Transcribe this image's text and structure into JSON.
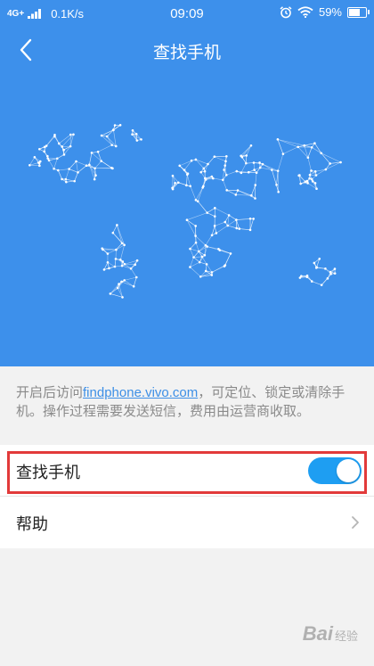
{
  "status_bar": {
    "network": "4G+",
    "speed": "0.1K/s",
    "time": "09:09",
    "battery": "59%",
    "battery_level": 0.59
  },
  "header": {
    "title": "查找手机",
    "bg_color": "#3d90eb"
  },
  "description": {
    "prefix": "开启后访问",
    "link": "findphone.vivo.com",
    "suffix": "，可定位、锁定或清除手机。操作过程需要发送短信，费用由运营商收取。"
  },
  "settings": {
    "find_phone": {
      "label": "查找手机",
      "enabled": true,
      "toggle_color": "#1e9ef2"
    },
    "help": {
      "label": "帮助"
    }
  },
  "watermark": {
    "brand": "Bai",
    "suffix": "经验"
  }
}
